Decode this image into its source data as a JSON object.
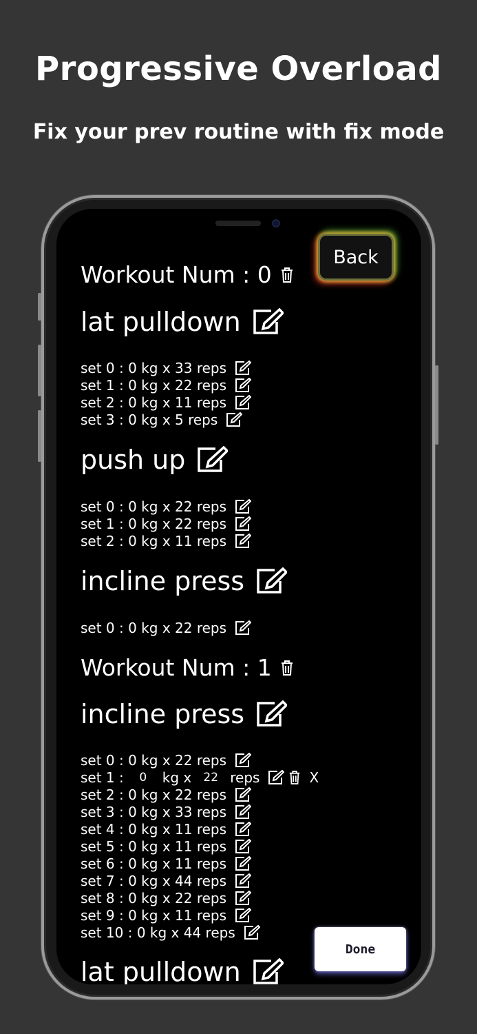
{
  "header": {
    "title": "Progressive Overload",
    "subtitle": "Fix your prev routine with fix mode"
  },
  "app": {
    "back_label": "Back",
    "done_label": "Done",
    "workout_0": {
      "label": "Workout Num : 0",
      "lat_pulldown": {
        "name": "lat pulldown",
        "sets": [
          "set 0 : 0 kg x 33 reps",
          "set 1 : 0 kg x 22 reps",
          "set 2 : 0 kg x 11 reps",
          "set 3 : 0 kg x 5 reps"
        ]
      },
      "push_up": {
        "name": "push up",
        "sets": [
          "set 0 : 0 kg x 22 reps",
          "set 1 : 0 kg x 22 reps",
          "set 2 : 0 kg x 11 reps"
        ]
      },
      "incline_press": {
        "name": "incline press",
        "sets": [
          "set 0 : 0 kg x 22 reps"
        ]
      }
    },
    "workout_1": {
      "label": "Workout Num : 1",
      "incline_press": {
        "name": "incline press",
        "set_0": "set 0 : 0 kg x 22 reps",
        "editing_set": {
          "prefix": "set 1 :",
          "weight_value": "0",
          "weight_unit": "kg x",
          "reps_value": "22",
          "reps_unit": "reps",
          "close_label": "X"
        },
        "sets_rest": [
          "set 2 : 0 kg x 22 reps",
          "set 3 : 0 kg x 33 reps",
          "set 4 : 0 kg x 11 reps",
          "set 5 : 0 kg x 11 reps",
          "set 6 : 0 kg x 11 reps",
          "set 7 : 0 kg x 44 reps",
          "set 8 : 0 kg x 22 reps",
          "set 9 : 0 kg x 11 reps",
          "set 10 : 0 kg x 44 reps"
        ]
      },
      "lat_pulldown_partial": {
        "name": "lat pulldown"
      }
    }
  }
}
